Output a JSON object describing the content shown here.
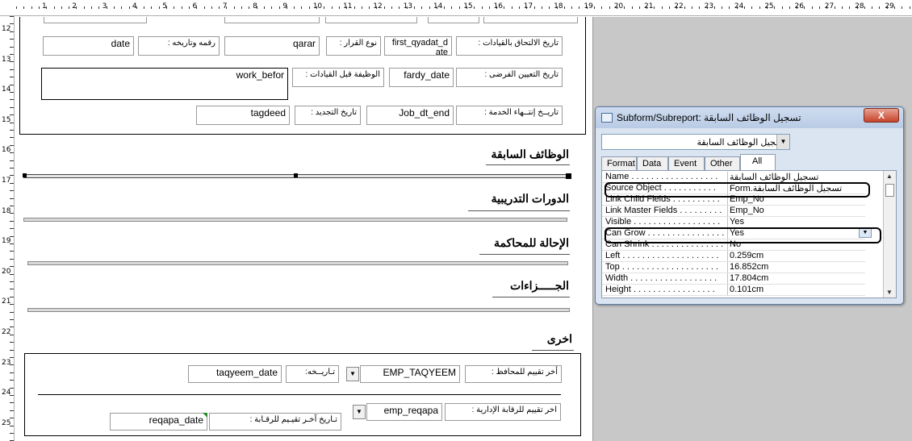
{
  "ruler": {
    "top_numbers": [
      "1",
      "2",
      "3",
      "4",
      "5",
      "6",
      "7",
      "8",
      "9",
      "10",
      "11",
      "12",
      "13",
      "14",
      "15",
      "16",
      "17",
      "18",
      "19",
      "20",
      "21",
      "22",
      "23",
      "24",
      "25",
      "26",
      "27",
      "28",
      "29"
    ],
    "left_numbers": [
      "12",
      "13",
      "14",
      "15",
      "16",
      "17",
      "18",
      "19",
      "20",
      "21",
      "22",
      "23",
      "24",
      "25"
    ]
  },
  "form": {
    "row1": {
      "date_value": "date",
      "date_label": "رقمه وتاريخه   :",
      "qarar_value": "qarar",
      "qarar_label": "نوع القرار :",
      "first_value": "first_qyadat_d\nate",
      "first_label": "تاريخ الالتحاق بالقيادات :"
    },
    "row2": {
      "work_value": "work_befor",
      "work_label": "الوظيفة قبل القيادات :",
      "fardy_value": "fardy_date",
      "fardy_label": "تاريخ التعيين الفرضى  :"
    },
    "row3": {
      "tagdeed_value": "tagdeed",
      "tagdeed_label": "تاريخ التجديد :",
      "job_value": "Job_dt_end",
      "job_label": "تاريــخ إنتــهاء الخدمة  :"
    },
    "sections": {
      "prev_jobs": "الوظائف السابقة",
      "training": "الدورات التدريبية",
      "trial": "الإحالة للمحاكمة",
      "penalties": "الجـــــزاءات",
      "other": "اخرى"
    },
    "bottom": {
      "taqyeem_date": "taqyeem_date",
      "taqyeem_date_label": "تـاريــخه:",
      "emp_taqyeem": "EMP_TAQYEEM",
      "emp_taqyeem_label": "أخر تقييم للمحافظ :",
      "emp_reqapa": "emp_reqapa",
      "emp_reqapa_label": "اخر تقييم للرقابة الإدارية :",
      "reqapa_date": "reqapa_date",
      "reqapa_date_label": "تـاريخ آخـر تقيـيم للرقـابة  :"
    }
  },
  "property_sheet": {
    "title": "Subform/Subreport: تسجيل الوظائف السابقة",
    "close_label": "X",
    "selector_value": "تسجيل الوظائف السابقة",
    "tabs": [
      {
        "label": "Format"
      },
      {
        "label": "Data"
      },
      {
        "label": "Event"
      },
      {
        "label": "Other"
      },
      {
        "label": "All"
      }
    ],
    "active_tab": "All",
    "properties": [
      {
        "name": "Name . . . . . . . . . . . . . . . . . .",
        "value": "تسجيل الوظائف السابقة"
      },
      {
        "name": "Source Object . . . . . . . . . . .",
        "value": "Form.تسجيل الوظائف السابقة"
      },
      {
        "name": "Link Child Fields . . . . . . . . . .",
        "value": "Emp_No"
      },
      {
        "name": "Link Master Fields . . . . . . . . .",
        "value": "Emp_No"
      },
      {
        "name": "Visible . . . . . . . . . . . . . . . . . .",
        "value": "Yes"
      },
      {
        "name": "Can Grow . . . . . . . . . . . . . . . .",
        "value": "Yes"
      },
      {
        "name": "Can Shrink . . . . . . . . . . . . . . .",
        "value": "No"
      },
      {
        "name": "Left . . . . . . . . . . . . . . . . . . . .",
        "value": "0.259cm"
      },
      {
        "name": "Top . . . . . . . . . . . . . . . . . . . .",
        "value": "16.852cm"
      },
      {
        "name": "Width . . . . . . . . . . . . . . . . . .",
        "value": "17.804cm"
      },
      {
        "name": "Height . . . . . . . . . . . . . . . . .",
        "value": "0.101cm"
      }
    ]
  }
}
